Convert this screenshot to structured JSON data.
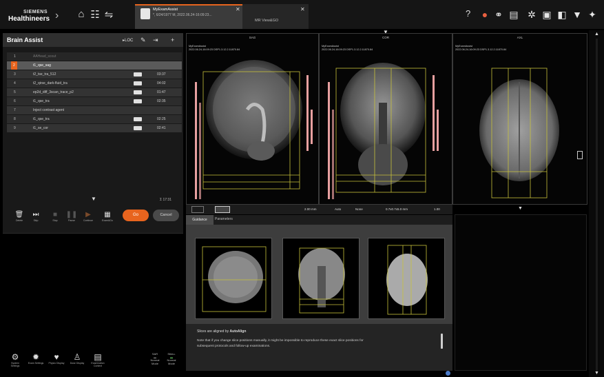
{
  "header": {
    "brand_line1": "SIEMENS",
    "brand_line2": "Healthineers",
    "active_tab": {
      "title": "MyExamAssist",
      "subtitle": "*, 6/24/1977 M, 2022.06.24-16:09:23..."
    },
    "second_tab": {
      "title": "MR View&GO"
    },
    "left_icons": [
      "home-icon",
      "patient-browser-icon",
      "workflow-icon"
    ],
    "right_icons": [
      "help-icon",
      "status-icon",
      "network-icon",
      "queue-icon",
      "settings-icon",
      "tools-icon",
      "camera-icon",
      "cart-icon",
      "extra-icon"
    ]
  },
  "program": {
    "title": "Brain Assist",
    "loc_label": "LOC",
    "rows": [
      {
        "n": "1",
        "name": "AAHead_scout",
        "time": ""
      },
      {
        "n": "2",
        "name": "t1_qse_sag",
        "time": ""
      },
      {
        "n": "3",
        "name": "t2_tse_tra_512",
        "time": "03:37"
      },
      {
        "n": "4",
        "name": "t2_qirse_dark-fluid_tra",
        "time": "04:02"
      },
      {
        "n": "5",
        "name": "ep2d_diff_3scan_trace_p2",
        "time": "01:47"
      },
      {
        "n": "6",
        "name": "t1_qse_tra",
        "time": "02:35"
      },
      {
        "n": "7",
        "name": "Inject contrast agent",
        "time": ""
      },
      {
        "n": "8",
        "name": "t1_qse_tra",
        "time": "02:25"
      },
      {
        "n": "9",
        "name": "t1_se_cor",
        "time": "02:41"
      }
    ],
    "total_time": "Σ 17:31",
    "controls": [
      {
        "icon": "trash-icon",
        "label": "Delete"
      },
      {
        "icon": "skip-icon",
        "label": "Skip"
      },
      {
        "icon": "stop-icon",
        "label": "Stop"
      },
      {
        "icon": "pause-icon",
        "label": "Pause"
      },
      {
        "icon": "continue-icon",
        "label": "Continue"
      },
      {
        "icon": "exam-icon",
        "label": "Exam&Go"
      }
    ],
    "go_label": "Go",
    "cancel_label": "Cancel"
  },
  "bottom_left": {
    "buttons": [
      {
        "icon": "settings-icon",
        "label": "System Settings"
      },
      {
        "icon": "gear-icon",
        "label": "Exam Settings"
      },
      {
        "icon": "heart-icon",
        "label": "Physio Display"
      },
      {
        "icon": "person-icon",
        "label": "Dose Display"
      },
      {
        "icon": "report-icon",
        "label": "Examination Context"
      }
    ],
    "mode1": {
      "top": "SAR",
      "bottom": "Normal Mode"
    },
    "mode2": {
      "top": "Stimu.",
      "bottom": "Normal Mode"
    }
  },
  "viewports": [
    {
      "title": "SAG",
      "overlay_top": [
        "MyExamAssist",
        "2022.06.24-16:09:23 DSP1.3.12.2.11870.84"
      ],
      "orientation": "SAG"
    },
    {
      "title": "COR",
      "overlay_top": [
        "MyExamAssist",
        "2022.06.24-16:09:23 DSP1.3.12.2.11870.84"
      ],
      "orientation": "COR"
    },
    {
      "title": "AXL",
      "overlay_top": [
        "MyExamAssist",
        "2022.06.24-16:09:23 DSP1.3.12.2.11870.84"
      ],
      "orientation": "AXL"
    }
  ],
  "viewport_bar": {
    "thickness": "2.00 mm",
    "auto": "Auto",
    "none": "None",
    "resolution": "0.7x0.7x5.0 mm",
    "factor": "1.00"
  },
  "guidance": {
    "tab_guidance": "Guidance",
    "tab_parameters": "Parameters",
    "line1_prefix": "Slices are aligned by ",
    "line1_bold": "AutoAlign",
    "line2": "Note that if you change slice positions manually, it might be impossible to reproduce these exact slice positions for",
    "line3": "subsequent protocols and follow-up examinations."
  },
  "colors": {
    "accent": "#e8641e",
    "overlay": "#c8c23a",
    "pink": "#e8a0a0"
  }
}
